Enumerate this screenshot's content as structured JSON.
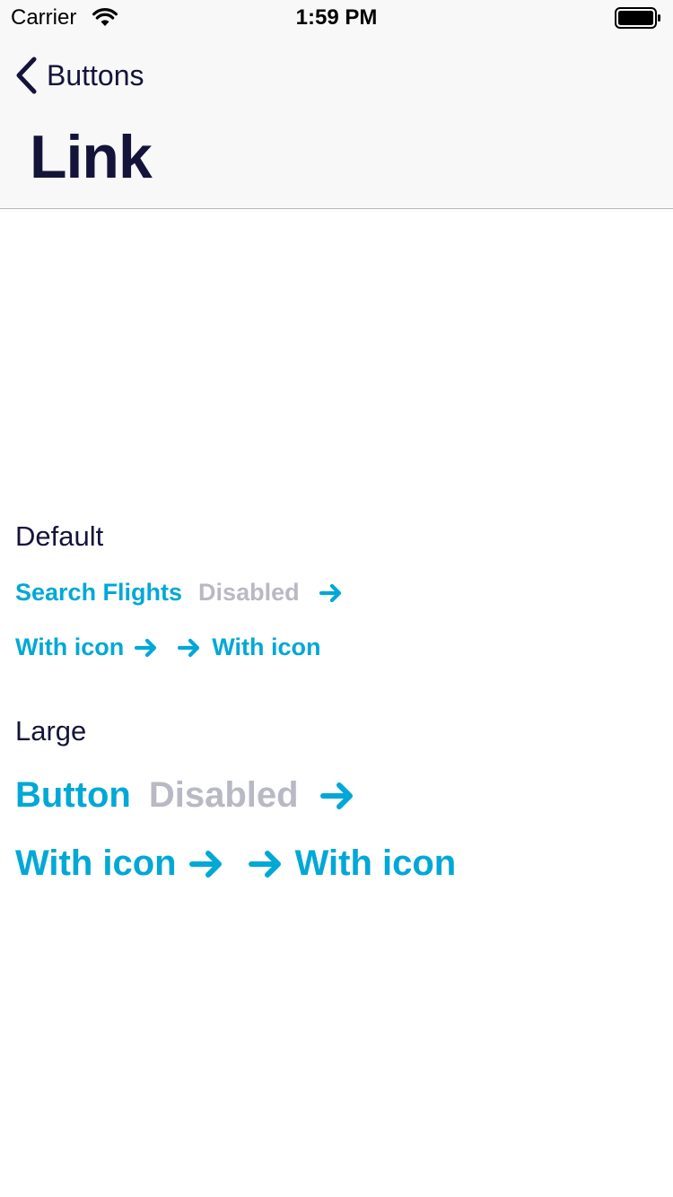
{
  "status_bar": {
    "carrier": "Carrier",
    "time": "1:59 PM"
  },
  "nav": {
    "back_label": "Buttons",
    "title": "Link"
  },
  "sections": {
    "default": {
      "label": "Default",
      "search_flights": "Search Flights",
      "disabled": "Disabled",
      "with_icon_trailing": "With icon",
      "with_icon_leading": "With icon"
    },
    "large": {
      "label": "Large",
      "button": "Button",
      "disabled": "Disabled",
      "with_icon_trailing": "With icon",
      "with_icon_leading": "With icon"
    }
  },
  "colors": {
    "link": "#00a8d6",
    "disabled": "#b8b9c4",
    "text": "#14143a",
    "header_bg": "#f8f8f8"
  },
  "icons": {
    "arrow": "arrow-right-icon",
    "back": "chevron-left-icon",
    "wifi": "wifi-icon",
    "battery": "battery-icon"
  }
}
